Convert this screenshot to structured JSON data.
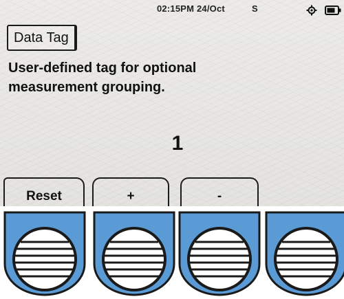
{
  "status": {
    "time_date": "02:15PM 24/Oct",
    "indicator": "S"
  },
  "screen": {
    "title": "Data Tag",
    "description_line1": "User-defined tag for optional",
    "description_line2": "measurement grouping.",
    "value": "1"
  },
  "softkeys": {
    "reset": "Reset",
    "plus": "+",
    "minus": "-"
  },
  "colors": {
    "screen_bg": "#e8e7e3",
    "button_blue": "#5a9bd5",
    "outline": "#1a1a1a"
  },
  "icons": [
    "gps-icon",
    "battery-icon",
    "hardware-button-icon"
  ]
}
